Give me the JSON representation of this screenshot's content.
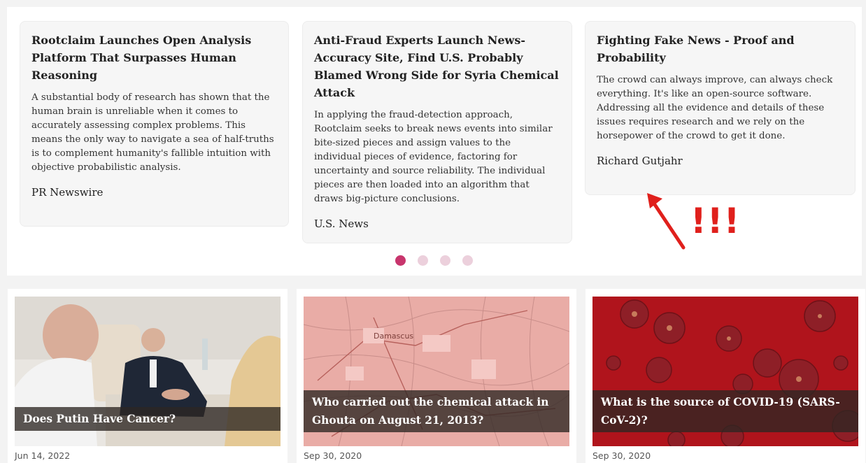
{
  "testimonials": [
    {
      "title": "Rootclaim Launches Open Analysis Platform That Surpasses Human Reasoning",
      "body": "A substantial body of research has shown that the human brain is unreliable when it comes to accurately assessing complex problems. This means the only way to navigate a sea of half-truths is to complement humanity's fallible intuition with objective probabilistic analysis.",
      "source": "PR Newswire"
    },
    {
      "title": "Anti-Fraud Experts Launch News-Accuracy Site, Find U.S. Probably Blamed Wrong Side for Syria Chemical Attack",
      "body": "In applying the fraud-detection approach, Rootclaim seeks to break news events into similar bite-sized pieces and assign values to the individual pieces of evidence, factoring for uncertainty and source reliability. The individual pieces are then loaded into an algorithm that draws big-picture conclusions.",
      "source": "U.S. News"
    },
    {
      "title": "Fighting Fake News - Proof and Probability",
      "body": "The crowd can always improve, can always check everything. It's like an open-source software. Addressing all the evidence and details of these issues requires research and we rely on the horsepower of the crowd to get it done.",
      "source": "Richard Gutjahr"
    }
  ],
  "carousel": {
    "pages": 4,
    "active_index": 0
  },
  "annotation": {
    "text": "!!!",
    "color": "#e0201c"
  },
  "articles": [
    {
      "caption": "Does Putin Have Cancer?",
      "date": "Jun 14, 2022",
      "image_icon": "putin-meeting-photo"
    },
    {
      "caption": "Who carried out the chemical attack in Ghouta on August 21, 2013?",
      "date": "Sep 30, 2020",
      "image_icon": "damascus-map-image",
      "map_label": "Damascus"
    },
    {
      "caption": "What is the source of COVID-19 (SARS-CoV-2)?",
      "date": "Sep 30, 2020",
      "image_icon": "virus-illustration"
    }
  ],
  "colors": {
    "accent": "#c8356d",
    "dot_inactive": "#ecd0dc",
    "covid_red": "#b0141c"
  }
}
